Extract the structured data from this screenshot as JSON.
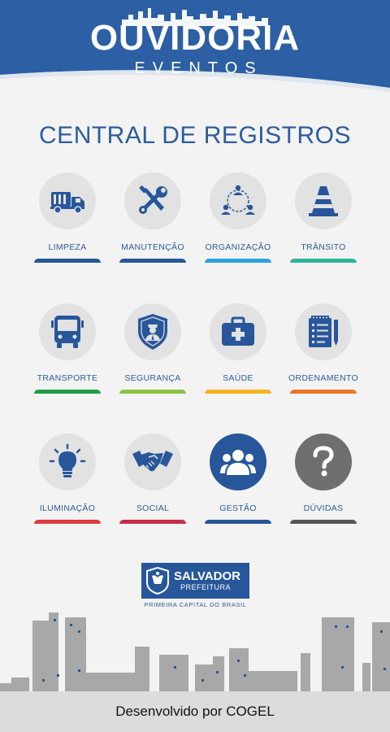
{
  "header": {
    "title": "OUVIDORIA",
    "subtitle": "EVENTOS",
    "color": "#2c5fa3"
  },
  "main": {
    "title": "CENTRAL DE REGISTROS",
    "categories": [
      {
        "label": "LIMPEZA",
        "icon": "garbage-truck-icon",
        "bar_color": "#27569a"
      },
      {
        "label": "MANUTENÇÃO",
        "icon": "tools-icon",
        "bar_color": "#27569a"
      },
      {
        "label": "ORGANIZAÇÃO",
        "icon": "people-network-icon",
        "bar_color": "#2ba3dc"
      },
      {
        "label": "TRÂNSITO",
        "icon": "traffic-cone-icon",
        "bar_color": "#2cb39b"
      },
      {
        "label": "TRANSPORTE",
        "icon": "bus-icon",
        "bar_color": "#1f9c49"
      },
      {
        "label": "SEGURANÇA",
        "icon": "security-guard-shield-icon",
        "bar_color": "#8ac43f"
      },
      {
        "label": "SAÚDE",
        "icon": "first-aid-kit-icon",
        "bar_color": "#f2b51f"
      },
      {
        "label": "ORDENAMENTO",
        "icon": "checklist-icon",
        "bar_color": "#ec7425"
      },
      {
        "label": "ILUMINAÇÃO",
        "icon": "light-bulb-icon",
        "bar_color": "#e03a3f"
      },
      {
        "label": "SOCIAL",
        "icon": "handshake-icon",
        "bar_color": "#c72c48"
      },
      {
        "label": "GESTÃO",
        "icon": "group-icon",
        "bar_color": "#27569a"
      },
      {
        "label": "DÚVIDAS",
        "icon": "question-mark-icon",
        "bar_color": "#555555"
      }
    ]
  },
  "logo": {
    "name": "SALVADOR",
    "sub": "PREFEITURA",
    "tagline": "PRIMEIRA CAPITAL DO BRASIL"
  },
  "footer": {
    "text": "Desenvolvido por COGEL"
  },
  "colors": {
    "primary": "#27569a",
    "title_text": "#2c5c9c",
    "icon_circle": "#e2e2e2",
    "city_gray": "#a8a8a8"
  }
}
